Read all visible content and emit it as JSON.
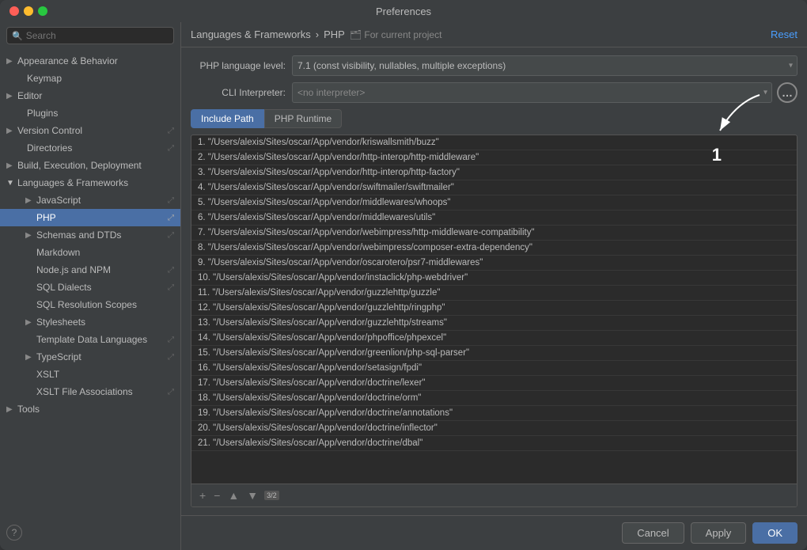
{
  "window": {
    "title": "Preferences"
  },
  "sidebar": {
    "search_placeholder": "🔍",
    "items": [
      {
        "label": "Appearance & Behavior",
        "level": 0,
        "arrow": "▶",
        "selected": false
      },
      {
        "label": "Keymap",
        "level": 0,
        "arrow": "",
        "selected": false
      },
      {
        "label": "Editor",
        "level": 0,
        "arrow": "▶",
        "selected": false
      },
      {
        "label": "Plugins",
        "level": 0,
        "arrow": "",
        "selected": false
      },
      {
        "label": "Version Control",
        "level": 0,
        "arrow": "▶",
        "selected": false,
        "hasIcon": true
      },
      {
        "label": "Directories",
        "level": 1,
        "arrow": "",
        "selected": false,
        "hasIcon": true
      },
      {
        "label": "Build, Execution, Deployment",
        "level": 0,
        "arrow": "▶",
        "selected": false
      },
      {
        "label": "Languages & Frameworks",
        "level": 0,
        "arrow": "▼",
        "selected": false
      },
      {
        "label": "JavaScript",
        "level": 1,
        "arrow": "▶",
        "selected": false,
        "hasIcon": true
      },
      {
        "label": "PHP",
        "level": 1,
        "arrow": "",
        "selected": true,
        "hasIcon": true
      },
      {
        "label": "Schemas and DTDs",
        "level": 1,
        "arrow": "▶",
        "selected": false,
        "hasIcon": true
      },
      {
        "label": "Markdown",
        "level": 1,
        "arrow": "",
        "selected": false
      },
      {
        "label": "Node.js and NPM",
        "level": 1,
        "arrow": "",
        "selected": false,
        "hasIcon": true
      },
      {
        "label": "SQL Dialects",
        "level": 1,
        "arrow": "",
        "selected": false,
        "hasIcon": true
      },
      {
        "label": "SQL Resolution Scopes",
        "level": 1,
        "arrow": "",
        "selected": false
      },
      {
        "label": "Stylesheets",
        "level": 1,
        "arrow": "▶",
        "selected": false
      },
      {
        "label": "Template Data Languages",
        "level": 1,
        "arrow": "",
        "selected": false,
        "hasIcon": true
      },
      {
        "label": "TypeScript",
        "level": 1,
        "arrow": "▶",
        "selected": false,
        "hasIcon": true
      },
      {
        "label": "XSLT",
        "level": 1,
        "arrow": "",
        "selected": false
      },
      {
        "label": "XSLT File Associations",
        "level": 1,
        "arrow": "",
        "selected": false,
        "hasIcon": true
      },
      {
        "label": "Tools",
        "level": 0,
        "arrow": "▶",
        "selected": false
      }
    ]
  },
  "panel": {
    "breadcrumb1": "Languages & Frameworks",
    "breadcrumb_sep": "›",
    "breadcrumb2": "PHP",
    "breadcrumb_sub": "For current project",
    "reset_label": "Reset",
    "php_language_label": "PHP language level:",
    "php_language_value": "7.1 (const visibility, nullables, multiple exceptions)",
    "cli_interpreter_label": "CLI Interpreter:",
    "cli_interpreter_value": "<no interpreter>",
    "tabs": [
      {
        "label": "Include Path",
        "active": true
      },
      {
        "label": "PHP Runtime",
        "active": false
      }
    ],
    "include_paths": [
      "1. \"/Users/alexis/Sites/oscar/App/vendor/kriswallsmith/buzz\"",
      "2. \"/Users/alexis/Sites/oscar/App/vendor/http-interop/http-middleware\"",
      "3. \"/Users/alexis/Sites/oscar/App/vendor/http-interop/http-factory\"",
      "4. \"/Users/alexis/Sites/oscar/App/vendor/swiftmailer/swiftmailer\"",
      "5. \"/Users/alexis/Sites/oscar/App/vendor/middlewares/whoops\"",
      "6. \"/Users/alexis/Sites/oscar/App/vendor/middlewares/utils\"",
      "7. \"/Users/alexis/Sites/oscar/App/vendor/webimpress/http-middleware-compatibility\"",
      "8. \"/Users/alexis/Sites/oscar/App/vendor/webimpress/composer-extra-dependency\"",
      "9. \"/Users/alexis/Sites/oscar/App/vendor/oscarotero/psr7-middlewares\"",
      "10. \"/Users/alexis/Sites/oscar/App/vendor/instaclick/php-webdriver\"",
      "11. \"/Users/alexis/Sites/oscar/App/vendor/guzzlehttp/guzzle\"",
      "12. \"/Users/alexis/Sites/oscar/App/vendor/guzzlehttp/ringphp\"",
      "13. \"/Users/alexis/Sites/oscar/App/vendor/guzzlehttp/streams\"",
      "14. \"/Users/alexis/Sites/oscar/App/vendor/phpoffice/phpexcel\"",
      "15. \"/Users/alexis/Sites/oscar/App/vendor/greenlion/php-sql-parser\"",
      "16. \"/Users/alexis/Sites/oscar/App/vendor/setasign/fpdi\"",
      "17. \"/Users/alexis/Sites/oscar/App/vendor/doctrine/lexer\"",
      "18. \"/Users/alexis/Sites/oscar/App/vendor/doctrine/orm\"",
      "19. \"/Users/alexis/Sites/oscar/App/vendor/doctrine/annotations\"",
      "20. \"/Users/alexis/Sites/oscar/App/vendor/doctrine/inflector\"",
      "21. \"/Users/alexis/Sites/oscar/App/vendor/doctrine/dbal\""
    ],
    "toolbar_buttons": [
      "+",
      "−",
      "▲",
      "▼"
    ],
    "sort_badge": "3/2"
  },
  "bottom": {
    "cancel_label": "Cancel",
    "apply_label": "Apply",
    "ok_label": "OK"
  }
}
